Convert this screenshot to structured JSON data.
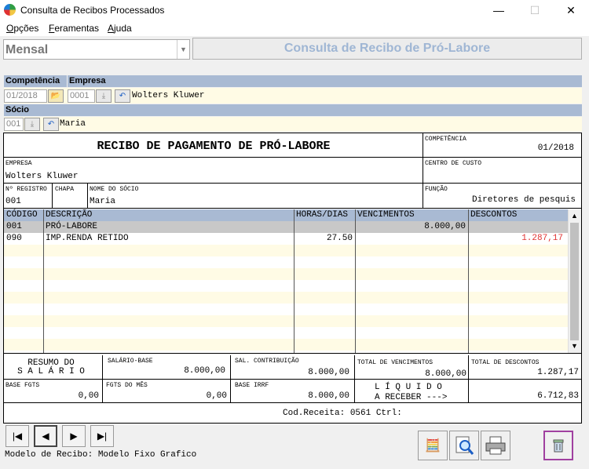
{
  "window": {
    "title": "Consulta de Recibos Processados",
    "min": "—",
    "max": "☐",
    "close": "✕"
  },
  "menu": [
    "Opções",
    "Feramentas",
    "Ajuda"
  ],
  "period_combo": {
    "value": "Mensal"
  },
  "banner": "Consulta de Recibo de Pró-Labore",
  "filters": {
    "competencia_label": "Competência",
    "empresa_label": "Empresa",
    "competencia_value": "01/2018",
    "empresa_code": "0001",
    "empresa_name": "Wolters Kluwer",
    "socio_label": "Sócio",
    "socio_code": "001",
    "socio_name": "Maria"
  },
  "receipt": {
    "title": "RECIBO DE PAGAMENTO DE PRÓ-LABORE",
    "competencia_label": "COMPETÊNCIA",
    "competencia_value": "01/2018",
    "empresa_label": "EMPRESA",
    "empresa_value": "Wolters Kluwer",
    "centro_label": "CENTRO DE CUSTO",
    "registro_label": "Nº REGISTRO",
    "registro_value": "001",
    "chapa_label": "CHAPA",
    "nome_label": "NOME DO SÓCIO",
    "nome_value": "Maria",
    "funcao_label": "FUNÇÃO",
    "funcao_value": "Diretores de pesquis",
    "columns": [
      "CÓDIGO",
      "DESCRIÇÃO",
      "HORAS/DIAS",
      "VENCIMENTOS",
      "DESCONTOS"
    ],
    "rows": [
      {
        "codigo": "001",
        "descricao": "PRÓ-LABORE",
        "horas": "",
        "venc": "8.000,00",
        "desc": ""
      },
      {
        "codigo": "090",
        "descricao": "IMP.RENDA RETIDO",
        "horas": "27.50",
        "venc": "",
        "desc": "1.287,17"
      }
    ],
    "resumo_line1": "RESUMO DO",
    "resumo_line2": "S A L Á R I O",
    "salario_base_label": "SALÁRIO-BASE",
    "salario_base_value": "8.000,00",
    "sal_contrib_label": "SAL. CONTRIBUIÇÃO",
    "sal_contrib_value": "8.000,00",
    "total_venc_label": "TOTAL DE VENCIMENTOS",
    "total_venc_value": "8.000,00",
    "total_desc_label": "TOTAL DE DESCONTOS",
    "total_desc_value": "1.287,17",
    "base_fgts_label": "BASE FGTS",
    "base_fgts_value": "0,00",
    "fgts_mes_label": "FGTS DO MÊS",
    "fgts_mes_value": "0,00",
    "base_irrf_label": "BASE IRRF",
    "base_irrf_value": "8.000,00",
    "liquido_line1": "L Í Q U I D O",
    "liquido_line2": "A RECEBER --->",
    "liquido_value": "6.712,83",
    "footer": "Cod.Receita: 0561  Ctrl:"
  },
  "nav": {
    "first": "|◀",
    "prev": "◀",
    "next": "▶",
    "last": "▶|"
  },
  "status": "Modelo de Recibo: Modelo Fixo Grafico",
  "colors": {
    "header_band": "#a9bad3",
    "field_bg": "#fffbe5",
    "discount_red": "#e03131",
    "selected_border": "#a040a0"
  }
}
